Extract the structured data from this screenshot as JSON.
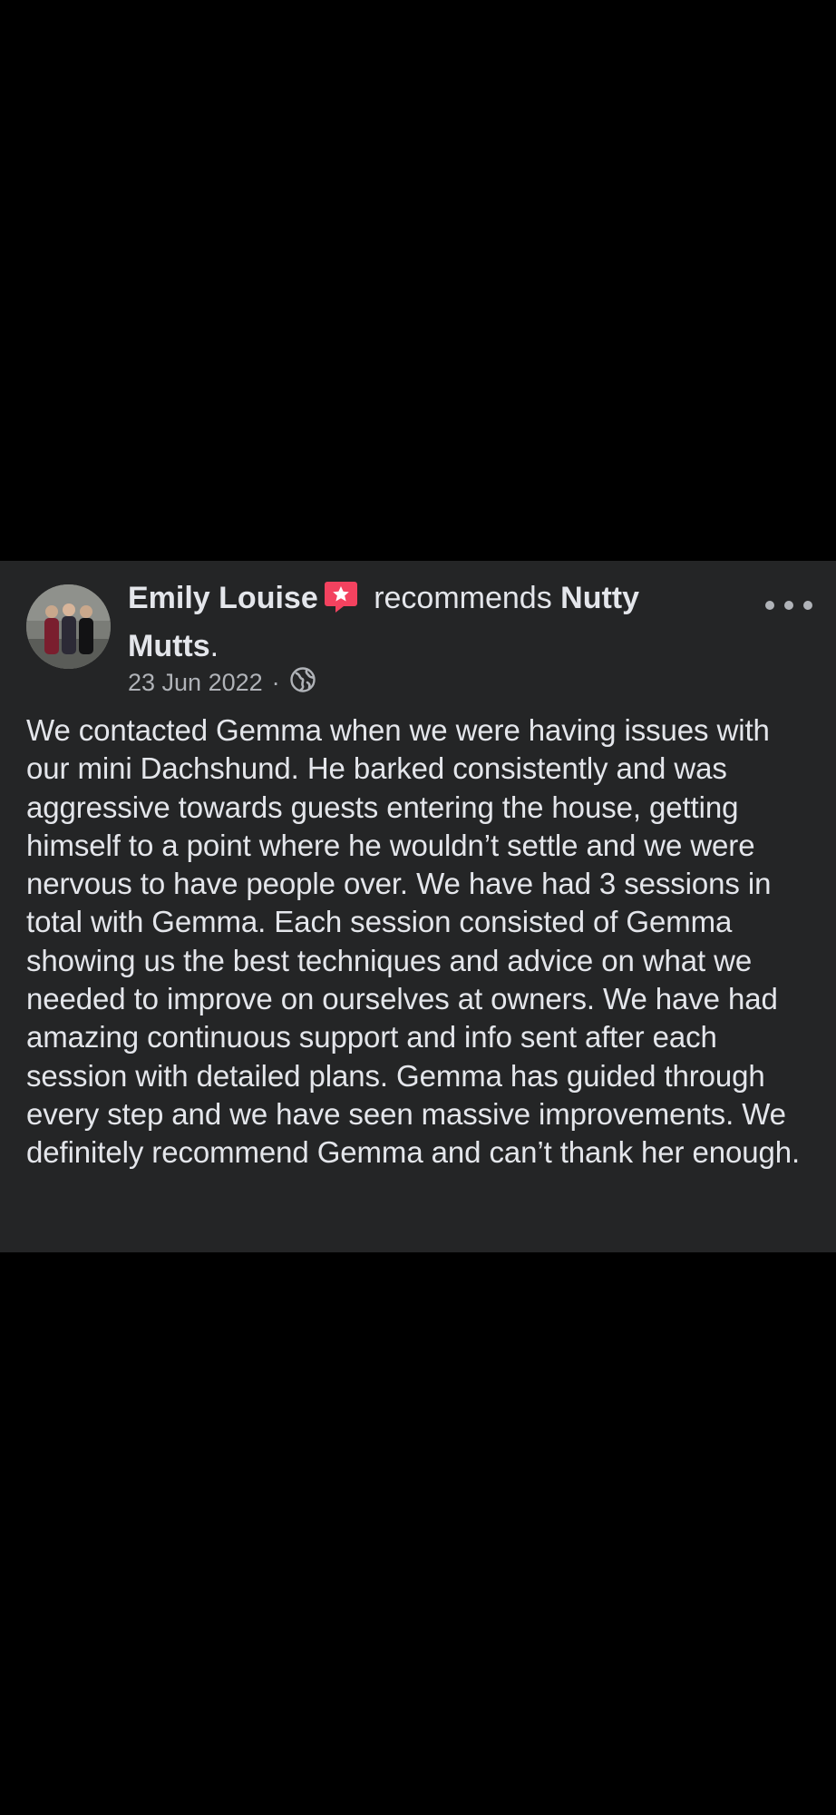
{
  "post": {
    "author_name": "Emily Louise",
    "action_text": "recommends",
    "page_name": "Nutty Mutts",
    "page_suffix": ".",
    "date": "23 Jun 2022",
    "separator": "·",
    "audience_icon": "globe-icon",
    "badge_icon": "recommend-star-icon",
    "more_icon": "more-options-icon",
    "body": "We contacted Gemma when we were having issues with our mini Dachshund. He barked consistently and was aggressive towards guests entering the house, getting himself to a point where he wouldn’t settle and we were nervous to have people over. We have had 3 sessions in total with Gemma. Each session consisted of Gemma showing us the best techniques and advice on what we needed to improve on ourselves at owners. We have had amazing continuous support and info sent after each session with detailed plans. Gemma has guided through every step and we have seen massive improvements. We definitely recommend Gemma and can’t thank her enough."
  },
  "colors": {
    "background": "#000000",
    "card": "#242526",
    "primary_text": "#e4e6eb",
    "secondary_text": "#b0b3b8",
    "badge": "#f3425f"
  }
}
